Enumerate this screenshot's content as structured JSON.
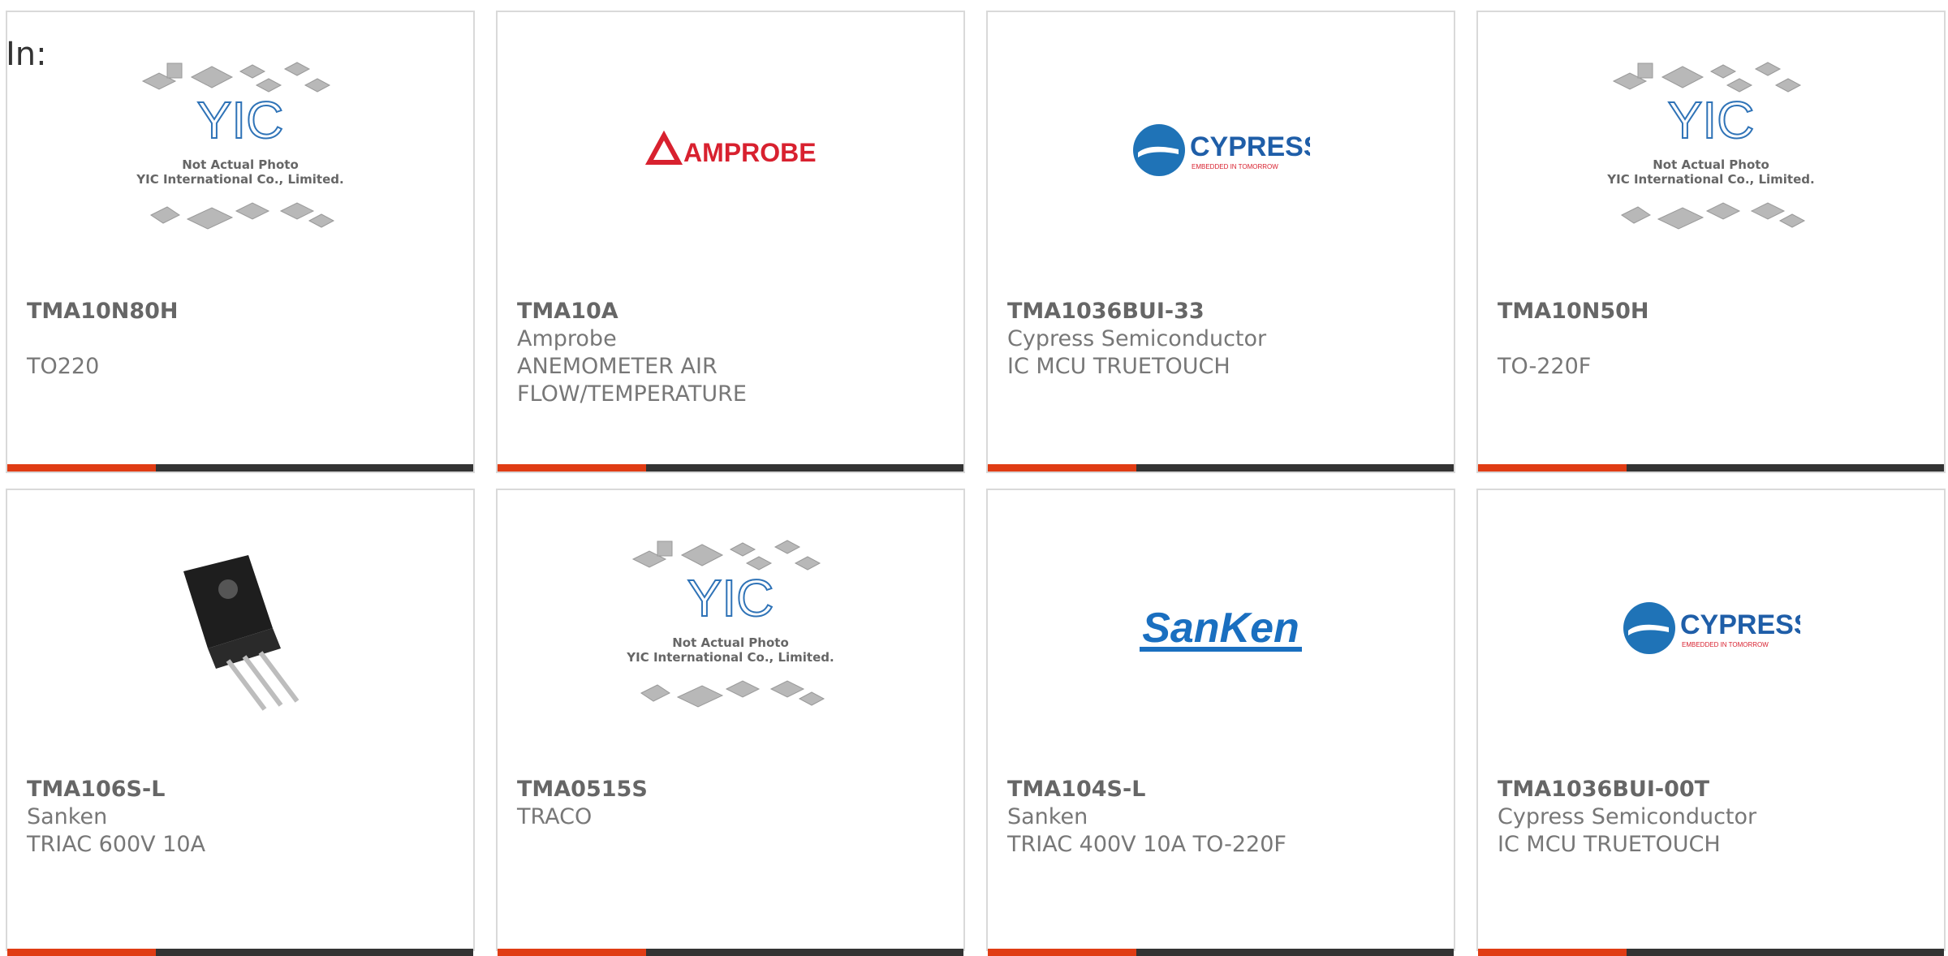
{
  "filter": {
    "label": "In:"
  },
  "colors": {
    "accent": "#e03c14",
    "bar": "#333333",
    "border": "#d9d9d9"
  },
  "placeholder": {
    "caption1": "Not Actual Photo",
    "caption2": "YIC International Co., Limited."
  },
  "logos": {
    "amprobe": "AMPROBE",
    "cypress": "CYPRESS",
    "cypress_tagline": "EMBEDDED IN TOMORROW",
    "sanken": "SanKen"
  },
  "products": [
    {
      "part": "TMA10N80H",
      "maker": "",
      "desc": "TO220",
      "image": "yic-placeholder"
    },
    {
      "part": "TMA10A",
      "maker": "Amprobe",
      "desc": "ANEMOMETER AIR FLOW/TEMPERATURE",
      "image": "amprobe-logo"
    },
    {
      "part": "TMA1036BUI-33",
      "maker": "Cypress Semiconductor",
      "desc": "IC MCU TRUETOUCH",
      "image": "cypress-logo"
    },
    {
      "part": "TMA10N50H",
      "maker": "",
      "desc": "TO-220F",
      "image": "yic-placeholder"
    },
    {
      "part": "TMA106S-L",
      "maker": "Sanken",
      "desc": "TRIAC 600V 10A",
      "image": "to220-photo"
    },
    {
      "part": "TMA0515S",
      "maker": "TRACO",
      "desc": "",
      "image": "yic-placeholder"
    },
    {
      "part": "TMA104S-L",
      "maker": "Sanken",
      "desc": "TRIAC 400V 10A TO-220F",
      "image": "sanken-logo"
    },
    {
      "part": "TMA1036BUI-00T",
      "maker": "Cypress Semiconductor",
      "desc": "IC MCU TRUETOUCH",
      "image": "cypress-logo"
    }
  ]
}
